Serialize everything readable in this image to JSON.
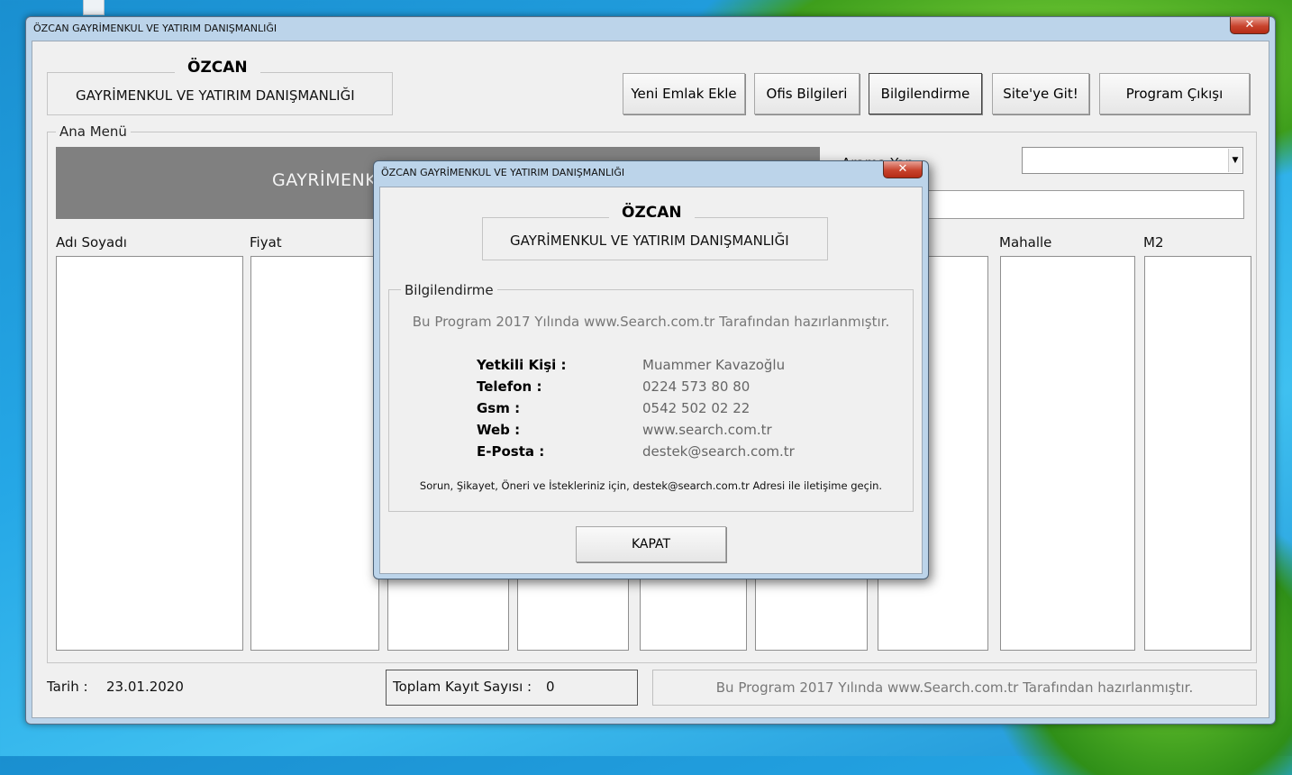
{
  "window": {
    "title": "ÖZCAN GAYRİMENKUL VE YATIRIM DANIŞMANLIĞI",
    "close_glyph": "✕"
  },
  "header": {
    "brand_title": "ÖZCAN",
    "brand_subtitle": "GAYRİMENKUL VE YATIRIM DANIŞMANLIĞI"
  },
  "toolbar": {
    "buttons": [
      {
        "label": "Yeni Emlak Ekle"
      },
      {
        "label": "Ofis Bilgileri"
      },
      {
        "label": "Bilgilendirme"
      },
      {
        "label": "Site'ye Git!"
      },
      {
        "label": "Program Çıkışı"
      }
    ]
  },
  "main_menu": {
    "legend": "Ana Menü",
    "banner_text": "GAYRİMENKUL",
    "search_label": "Arama Yap",
    "search_value": ""
  },
  "columns": [
    {
      "label": "Adı Soyadı"
    },
    {
      "label": "Fiyat"
    },
    {
      "label": "Mahalle"
    },
    {
      "label": "M2"
    }
  ],
  "status": {
    "date_label": "Tarih :",
    "date_value": "23.01.2020",
    "total_label": "Toplam Kayıt Sayısı :",
    "total_value": "0",
    "program_info": "Bu Program 2017 Yılında www.Search.com.tr Tarafından hazırlanmıştır."
  },
  "dialog": {
    "title": "ÖZCAN GAYRİMENKUL VE YATIRIM DANIŞMANLIĞI",
    "close_glyph": "✕",
    "brand_title": "ÖZCAN",
    "brand_subtitle": "GAYRİMENKUL VE YATIRIM DANIŞMANLIĞI",
    "legend": "Bilgilendirme",
    "program_info": "Bu Program 2017 Yılında www.Search.com.tr Tarafından hazırlanmıştır.",
    "rows": [
      {
        "label": "Yetkili Kişi :",
        "value": "Muammer Kavazoğlu"
      },
      {
        "label": "Telefon :",
        "value": "0224 573 80 80"
      },
      {
        "label": "Gsm :",
        "value": "0542 502 02 22"
      },
      {
        "label": "Web :",
        "value": "www.search.com.tr"
      },
      {
        "label": "E-Posta :",
        "value": "destek@search.com.tr"
      }
    ],
    "note": "Sorun, Şikayet, Öneri ve İstekleriniz için, destek@search.com.tr Adresi ile iletişime geçin.",
    "close_button": "KAPAT"
  }
}
